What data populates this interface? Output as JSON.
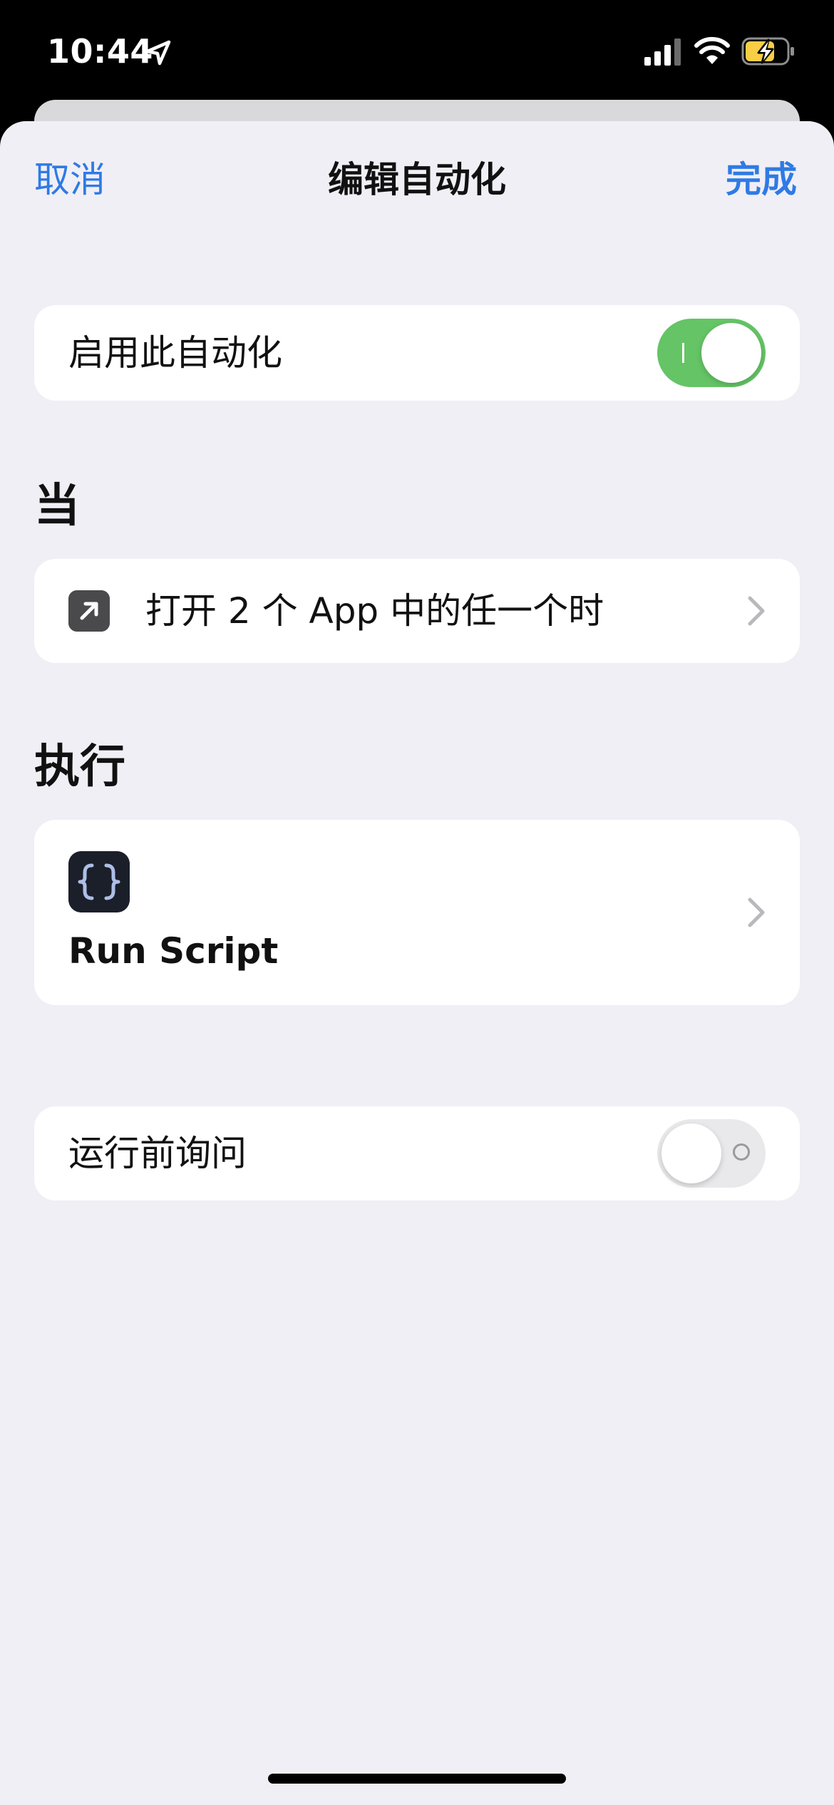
{
  "status_bar": {
    "time": "10:44",
    "icons": [
      "location-arrow-icon",
      "cellular-signal-icon",
      "wifi-icon",
      "battery-charging-icon"
    ]
  },
  "nav": {
    "cancel_label": "取消",
    "title": "编辑自动化",
    "done_label": "完成"
  },
  "enable_row": {
    "label": "启用此自动化",
    "enabled": true
  },
  "when_section": {
    "header": "当",
    "trigger_label": "打开 2 个 App 中的任一个时",
    "icon": "arrow-up-right-icon"
  },
  "do_section": {
    "header": "执行",
    "action_label": "Run Script",
    "icon": "curly-braces-icon"
  },
  "ask_row": {
    "label": "运行前询问",
    "enabled": false
  },
  "colors": {
    "accent": "#2f7ae5",
    "toggle_on": "#65c466",
    "background": "#f0eff5"
  }
}
